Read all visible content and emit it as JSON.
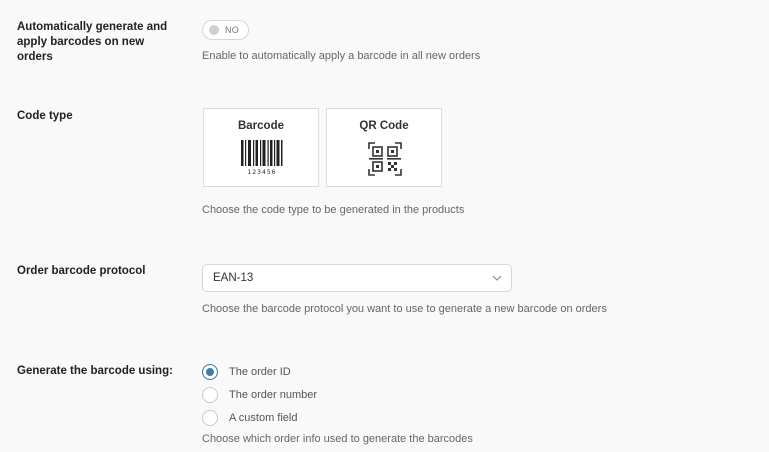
{
  "auto_generate": {
    "label": "Automatically generate and apply barcodes on new orders",
    "toggle_text": "NO",
    "description": "Enable to automatically apply a barcode in all new orders"
  },
  "code_type": {
    "label": "Code type",
    "options": [
      {
        "title": "Barcode",
        "icon": "barcode-icon",
        "sample_digits": "123456"
      },
      {
        "title": "QR Code",
        "icon": "qr-code-icon"
      }
    ],
    "description": "Choose the code type to be generated in the products"
  },
  "order_protocol": {
    "label": "Order barcode protocol",
    "selected": "EAN-13",
    "description": "Choose the barcode protocol you want to use to generate a new barcode on orders"
  },
  "generate_using": {
    "label": "Generate the barcode using:",
    "options": [
      {
        "label": "The order ID",
        "checked": true
      },
      {
        "label": "The order number",
        "checked": false
      },
      {
        "label": "A custom field",
        "checked": false
      }
    ],
    "description": "Choose which order info used to generate the barcodes"
  },
  "colors": {
    "accent": "#3f7ca9",
    "background": "#f9f9f9"
  }
}
